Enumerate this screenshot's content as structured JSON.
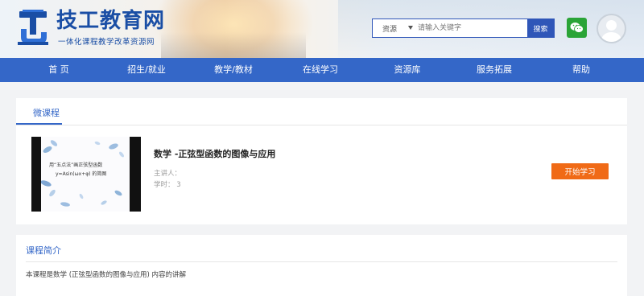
{
  "site": {
    "title": "技工教育网",
    "subtitle": "一体化课程教学改革资源网"
  },
  "search": {
    "scope_label": "资源",
    "placeholder": "请输入关键字",
    "button_label": "搜索"
  },
  "nav": {
    "items": [
      "首 页",
      "招生/就业",
      "教学/教材",
      "在线学习",
      "资源库",
      "服务拓展",
      "帮助"
    ]
  },
  "course_section": {
    "tab_label": "微课程",
    "thumbnail_text_line1": "用“五点法”画正弦型函数",
    "thumbnail_text_line2": "y=Asin(ωx+φ) 的简图",
    "title": "数学 -正弦型函数的图像与应用",
    "lecturer_label": "主讲人：",
    "hours_label": "学时：",
    "hours_value": "3",
    "start_button": "开始学习"
  },
  "intro_section": {
    "title": "课程简介",
    "text": "本课程是数学 (正弦型函数的图像与应用) 内容的讲解"
  },
  "colors": {
    "brand_blue": "#3467c8",
    "title_blue": "#1a4ea5",
    "start_orange": "#f06a16",
    "wechat_green": "#2aa437"
  },
  "icons": {
    "logo": "jigong-logo-icon",
    "wechat": "wechat-icon",
    "avatar": "user-avatar-icon",
    "dropdown": "caret-down-icon"
  }
}
